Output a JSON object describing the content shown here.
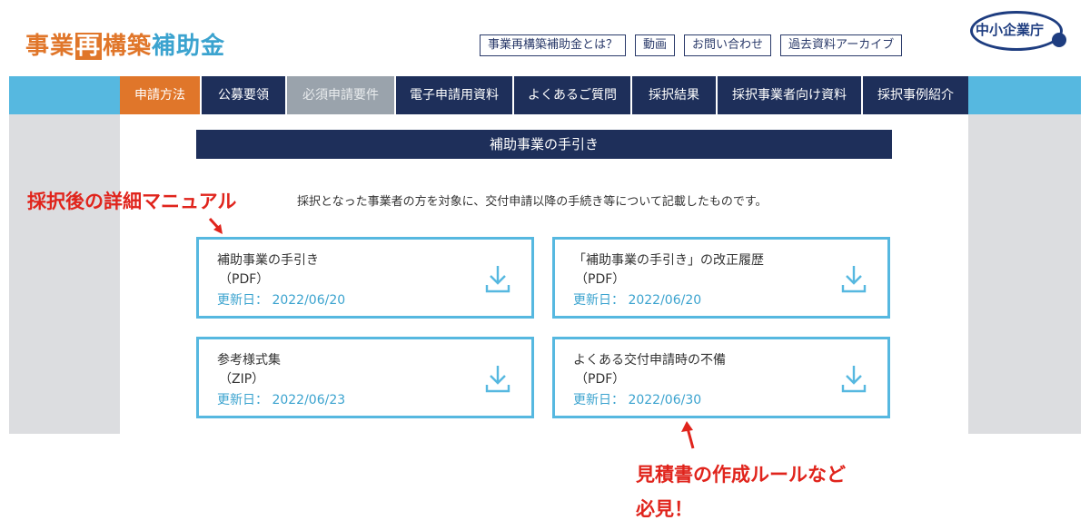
{
  "header": {
    "logo": {
      "part1": "事業",
      "part2": "再",
      "part3": "構築",
      "part4": "補助金"
    },
    "top_links": [
      "事業再構築補助金とは？",
      "動画",
      "お問い合わせ",
      "過去資料アーカイブ"
    ],
    "agency": "中小企業庁"
  },
  "nav": {
    "items": [
      {
        "label": "申請方法",
        "state": "active"
      },
      {
        "label": "公募要領",
        "state": "normal"
      },
      {
        "label": "必須申請要件",
        "state": "disabled"
      },
      {
        "label": "電子申請用資料",
        "state": "normal"
      },
      {
        "label": "よくあるご質問",
        "state": "normal"
      },
      {
        "label": "採択結果",
        "state": "normal"
      },
      {
        "label": "採択事業者向け資料",
        "state": "normal"
      },
      {
        "label": "採択事例紹介",
        "state": "normal"
      }
    ]
  },
  "main": {
    "section_title": "補助事業の手引き",
    "description": "採択となった事業者の方を対象に、交付申請以降の手続き等について記載したものです。",
    "cards": [
      {
        "title": "補助事業の手引き",
        "format": "（PDF）",
        "updated_label": "更新日：",
        "updated": "2022/06/20"
      },
      {
        "title": "「補助事業の手引き」の改正履歴",
        "format": "（PDF）",
        "updated_label": "更新日：",
        "updated": "2022/06/20"
      },
      {
        "title": "参考様式集",
        "format": "（ZIP）",
        "updated_label": "更新日：",
        "updated": "2022/06/23"
      },
      {
        "title": "よくある交付申請時の不備",
        "format": "（PDF）",
        "updated_label": "更新日：",
        "updated": "2022/06/30"
      }
    ]
  },
  "annotations": {
    "note1": "採択後の詳細マニュアル",
    "note2_line1": "見積書の作成ルールなど",
    "note2_line2": "必見！"
  },
  "colors": {
    "navy": "#1e2f5a",
    "orange": "#e0762a",
    "light_blue": "#56b8e0",
    "annotation_red": "#e0241c"
  }
}
